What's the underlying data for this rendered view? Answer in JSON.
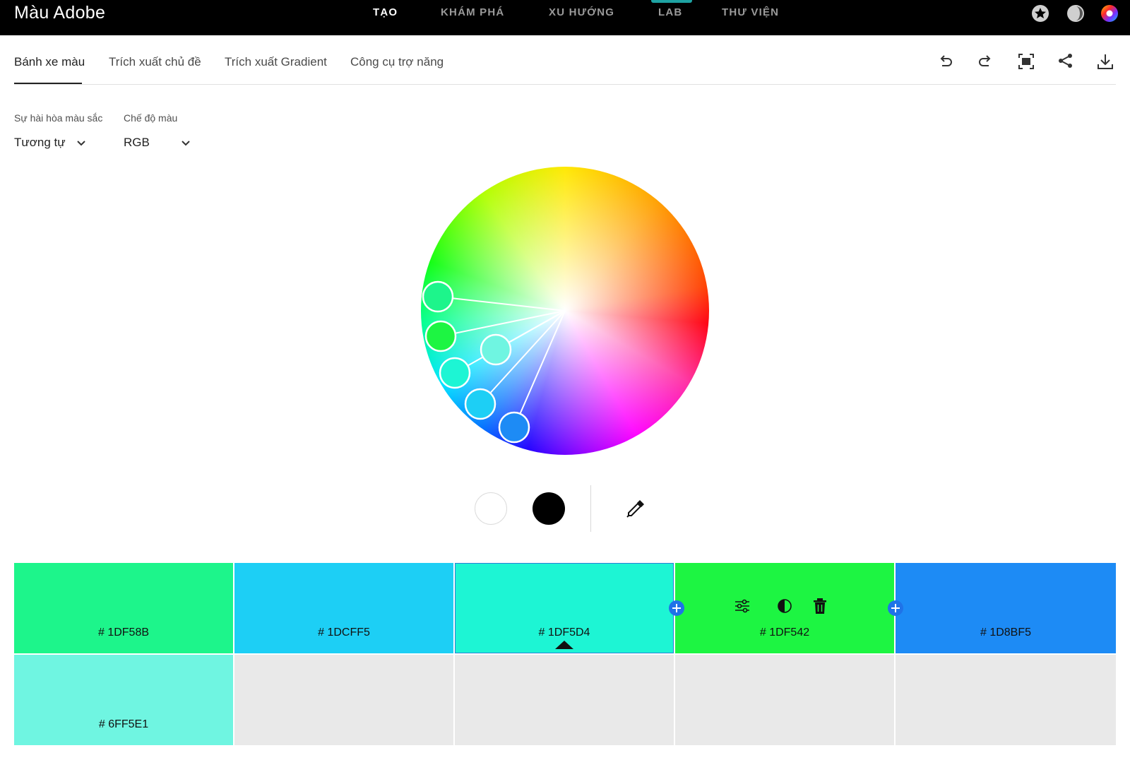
{
  "app": {
    "title": "Màu Adobe"
  },
  "topnav": {
    "items": [
      {
        "label": "TẠO",
        "active": true
      },
      {
        "label": "KHÁM PHÁ",
        "active": false
      },
      {
        "label": "XU HƯỚNG",
        "active": false
      },
      {
        "label": "LAB",
        "active": false
      },
      {
        "label": "THƯ VIỆN",
        "active": false
      }
    ],
    "icons": [
      "star-icon",
      "contrast-moon-icon",
      "color-wheel-profile-icon"
    ]
  },
  "subtabs": {
    "items": [
      {
        "label": "Bánh xe màu",
        "active": true
      },
      {
        "label": "Trích xuất chủ đề",
        "active": false
      },
      {
        "label": "Trích xuất Gradient",
        "active": false
      },
      {
        "label": "Công cụ trợ năng",
        "active": false
      }
    ],
    "tools": [
      "undo-icon",
      "redo-icon",
      "fullscreen-icon",
      "share-icon",
      "download-icon"
    ]
  },
  "controls": {
    "harmony_label": "Sự hài hòa màu sắc",
    "harmony_value": "Tương tự",
    "mode_label": "Chế độ màu",
    "mode_value": "RGB"
  },
  "wheel": {
    "markers": [
      "#1DF58B",
      "#1DF542",
      "#6FF5E1",
      "#1DF5D4",
      "#1DCFF5",
      "#1D8BF5"
    ]
  },
  "swatches": [
    {
      "hex": "# 1DF58B",
      "color": "#1DF58B",
      "selected": false
    },
    {
      "hex": "# 1DCFF5",
      "color": "#1DCFF5",
      "selected": false
    },
    {
      "hex": "# 1DF5D4",
      "color": "#1DF5D4",
      "selected": true
    },
    {
      "hex": "# 1DF542",
      "color": "#1DF542",
      "selected": false
    },
    {
      "hex": "# 1D8BF5",
      "color": "#1D8BF5",
      "selected": false
    }
  ],
  "second_row": [
    {
      "hex": "# 6FF5E1",
      "color": "#6FF5E1"
    }
  ],
  "colors": {
    "accent": "#1F73E8",
    "topbar": "#000000",
    "empty": "#E9E9E9"
  }
}
